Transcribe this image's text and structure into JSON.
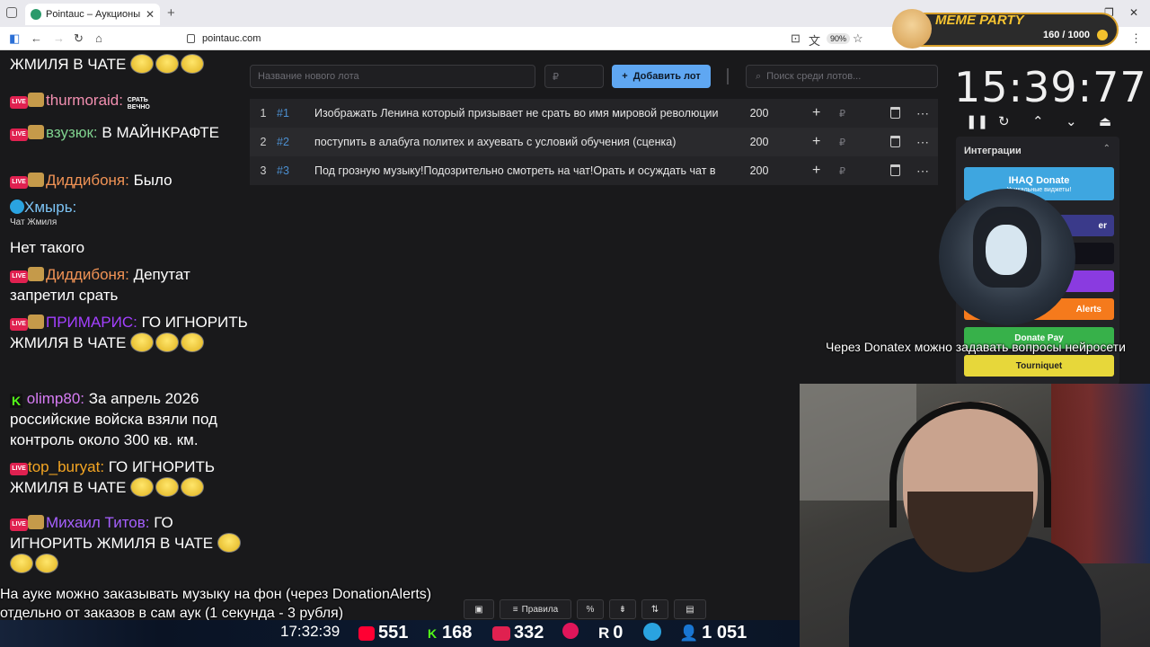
{
  "browser": {
    "tab_title": "Pointauc – Аукционы, лотереи",
    "url": "pointauc.com",
    "zoom": "90%"
  },
  "app": {
    "lot_name_placeholder": "Название нового лота",
    "amount_placeholder": "₽",
    "add_button": "Добавить лот",
    "search_placeholder": "Поиск среди лотов...",
    "lots": [
      {
        "index": "1",
        "id": "#1",
        "name": "Изображать Ленина который призывает не срать во имя мировой революции",
        "amount": "200",
        "currency": "₽"
      },
      {
        "index": "2",
        "id": "#2",
        "name": "поступить в алабуга политех и ахуевать с условий обучения (сценка)",
        "amount": "200",
        "currency": "₽"
      },
      {
        "index": "3",
        "id": "#3",
        "name": "Под грозную музыку!Подозрительно смотреть на чат!Орать и осуждать чат в",
        "amount": "200",
        "currency": "₽"
      }
    ],
    "timer": "15:39:77",
    "integrations": {
      "title": "Интеграции",
      "items": [
        {
          "label": "IHAQ Donate",
          "sub": "Уникальные виджеты!",
          "color": "#3ea6e0"
        },
        {
          "label": "er",
          "sub": "",
          "color": "#3a3a8a"
        },
        {
          "label": "",
          "sub": "",
          "color": "#111118"
        },
        {
          "label": "",
          "sub": "",
          "color": "#8a3be0"
        },
        {
          "label": "Alerts",
          "sub": "",
          "color": "#f57a1c"
        },
        {
          "label": "Donate Pay",
          "sub": "",
          "color": "#37b14a"
        },
        {
          "label": "Tourniquet",
          "sub": "",
          "color": "#e7d73a"
        }
      ]
    },
    "action_bar": {
      "rules": "Правила"
    }
  },
  "chat": {
    "messages": [
      {
        "user": "",
        "text": "ЖМИЛЯ В ЧАТЕ"
      },
      {
        "user": "thurmoraid:",
        "text": "",
        "badge": "СРАТЬ ВЕЧНО"
      },
      {
        "user": "взузюк:",
        "text": "В МАЙНКРАФТЕ"
      },
      {
        "user": "Диддибоня:",
        "text": "Было"
      },
      {
        "user": "Хмырь:",
        "text": "",
        "caption": "Чат Жмиля"
      },
      {
        "user": "",
        "text": "Нет такого"
      },
      {
        "user": "Диддибоня:",
        "text": "Депутат запретил срать"
      },
      {
        "user": "ПРИМАРИС:",
        "text": "ГО ИГНОРИТЬ ЖМИЛЯ В ЧАТЕ"
      },
      {
        "user": "olimp80:",
        "text": "За апрель 2026 российские войска взяли под контроль около 300 кв. км."
      },
      {
        "user": "top_buryat:",
        "text": "ГО ИГНОРИТЬ ЖМИЛЯ В ЧАТЕ"
      },
      {
        "user": "Михаил Титов:",
        "text": "ГО ИГНОРИТЬ ЖМИЛЯ В ЧАТЕ"
      }
    ]
  },
  "overlay": {
    "ticker": "Через Donatex можно задавать вопросы нейросети",
    "subtitle_line1": "На ауке можно заказывать музыку на фон (через DonationAlerts)",
    "subtitle_line2": "отдельно от заказов в сам аук (1 секунда - 3 рубля)",
    "meme_title": "MEME PARTY",
    "meme_progress": "160 / 1000",
    "clock": "17:32:39",
    "youtube": "551",
    "kick": "168",
    "vk_live": "332",
    "rumble": "0",
    "viewers": "1 051"
  }
}
